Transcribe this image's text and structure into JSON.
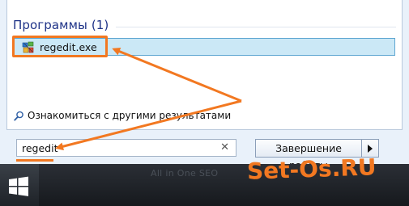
{
  "results": {
    "header": "Программы (1)",
    "items": [
      {
        "label": "regedit.exe",
        "icon": "registry-editor-icon"
      }
    ],
    "see_more": "Ознакомиться с другими результатами"
  },
  "search": {
    "value": "regedit",
    "clear_glyph": "✕"
  },
  "shutdown": {
    "label": "Завершение работы"
  },
  "watermark": {
    "left": "All in One SEO",
    "right": "Set-Os.RU"
  },
  "colors": {
    "annotation": "#f27821",
    "selection_fill": "#cbe8f6",
    "selection_border": "#5fa7d1",
    "header_text": "#1e3287"
  }
}
